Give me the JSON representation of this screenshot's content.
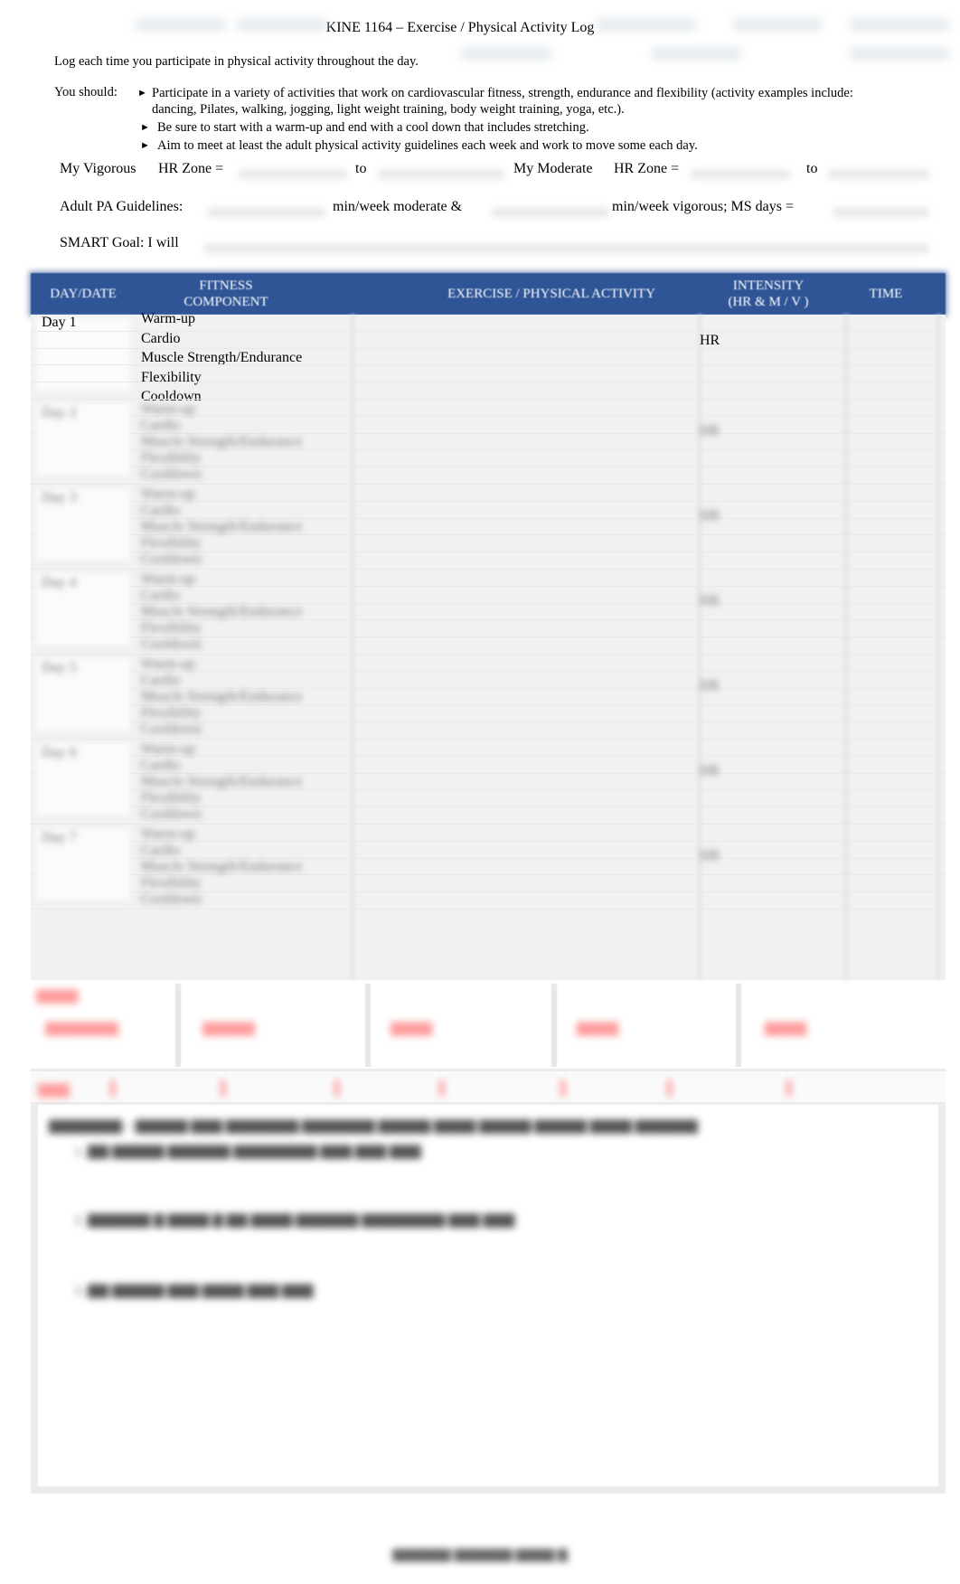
{
  "header": {
    "title": "KINE 1164 – Exercise / Physical Activity Log"
  },
  "instructions": {
    "intro": "Log each time you participate in physical activity throughout the day.",
    "should_label": "You should:",
    "bullets": [
      "Participate in a variety of activities that work on cardiovascular fitness, strength, endurance and flexibility (activity examples include:   dancing, Pilates, walking, jogging, light weight training, body weight training, yoga, etc.).",
      "Be sure to start with a warm-up and end with a cool down that includes stretching.",
      "Aim to meet at least the adult physical activity guidelines each week and work to move some each day."
    ],
    "bullet_glyph": "►"
  },
  "fields": {
    "vigorous_label": "My Vigorous",
    "vigorous_hr_label": "HR Zone =",
    "vigorous_to": "to",
    "moderate_label": "My Moderate",
    "moderate_hr_label": "HR Zone =",
    "moderate_to": "to",
    "guidelines_label": "Adult PA Guidelines:",
    "guidelines_moderate": "min/week moderate &",
    "guidelines_vigorous": "min/week vigorous; MS days =",
    "smart_goal_label": "SMART Goal: I will",
    "vigorous_hr_from": "",
    "vigorous_hr_to": "",
    "moderate_hr_from": "",
    "moderate_hr_to": "",
    "moderate_minutes": "",
    "vigorous_minutes": "",
    "ms_days": "",
    "smart_goal": ""
  },
  "table": {
    "header_color": "#2f5597",
    "columns": [
      {
        "line1": "DAY/DATE",
        "line2": ""
      },
      {
        "line1": "FITNESS",
        "line2": "COMPONENT"
      },
      {
        "line1": "EXERCISE / PHYSICAL ACTIVITY",
        "line2": ""
      },
      {
        "line1": "INTENSITY",
        "line2": "(HR  &  M / V )"
      },
      {
        "line1": "TIME",
        "line2": ""
      }
    ],
    "days": [
      {
        "label": "Day 1",
        "components": [
          "Warm-up",
          "Cardio",
          "Muscle Strength/Endurance",
          "Flexibility",
          "Cooldown"
        ],
        "intensity_label": "HR"
      }
    ],
    "blurred_day_count": 6
  },
  "summary_accent_color": "#ff9c9c"
}
